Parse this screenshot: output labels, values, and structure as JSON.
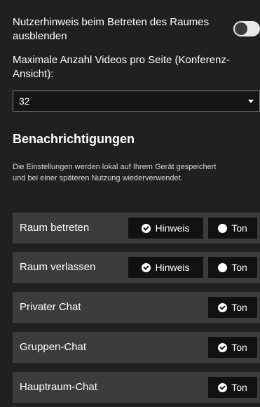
{
  "settings": {
    "hide_notice_label": "Nutzerhinweis beim Betreten des Raumes ausblenden",
    "hide_notice_enabled": false,
    "max_videos_label": "Maximale Anzahl Videos pro Seite (Konferenz-Ansicht):",
    "max_videos_value": "32"
  },
  "notifications": {
    "title": "Benachrichtigungen",
    "description": "Die Einstellungen werden lokal auf Ihrem Gerät gespeichert und bei einer späteren Nutzung wiederverwendet.",
    "rows": [
      {
        "label": "Raum betreten",
        "hinweis": "Hinweis",
        "hinweis_icon": "check-circle-icon",
        "ton": "Ton",
        "ton_icon": "dot-circle-icon"
      },
      {
        "label": "Raum verlassen",
        "hinweis": "Hinweis",
        "hinweis_icon": "check-circle-icon",
        "ton": "Ton",
        "ton_icon": "dot-circle-icon"
      },
      {
        "label": "Privater Chat",
        "ton": "Ton",
        "ton_icon": "check-circle-icon"
      },
      {
        "label": "Gruppen-Chat",
        "ton": "Ton",
        "ton_icon": "check-circle-icon"
      },
      {
        "label": "Hauptraum-Chat",
        "ton": "Ton",
        "ton_icon": "check-circle-icon"
      }
    ]
  }
}
